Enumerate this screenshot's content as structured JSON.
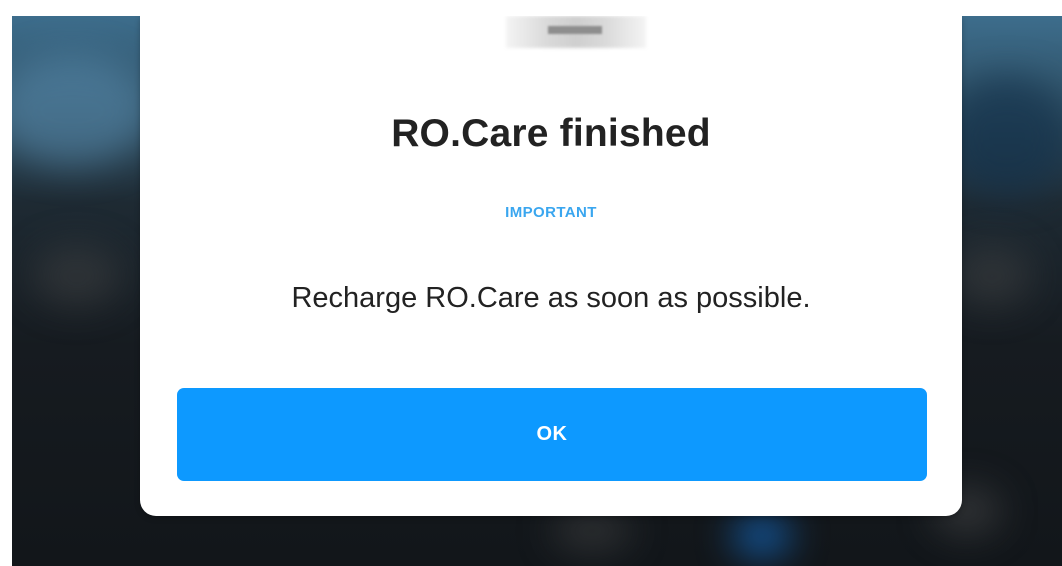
{
  "dialog": {
    "title": "RO.Care finished",
    "tag": "IMPORTANT",
    "message": "Recharge RO.Care as soon as possible.",
    "ok_label": "OK"
  },
  "colors": {
    "accent": "#0d99ff",
    "tag": "#3aa6ef",
    "text": "#222222"
  }
}
